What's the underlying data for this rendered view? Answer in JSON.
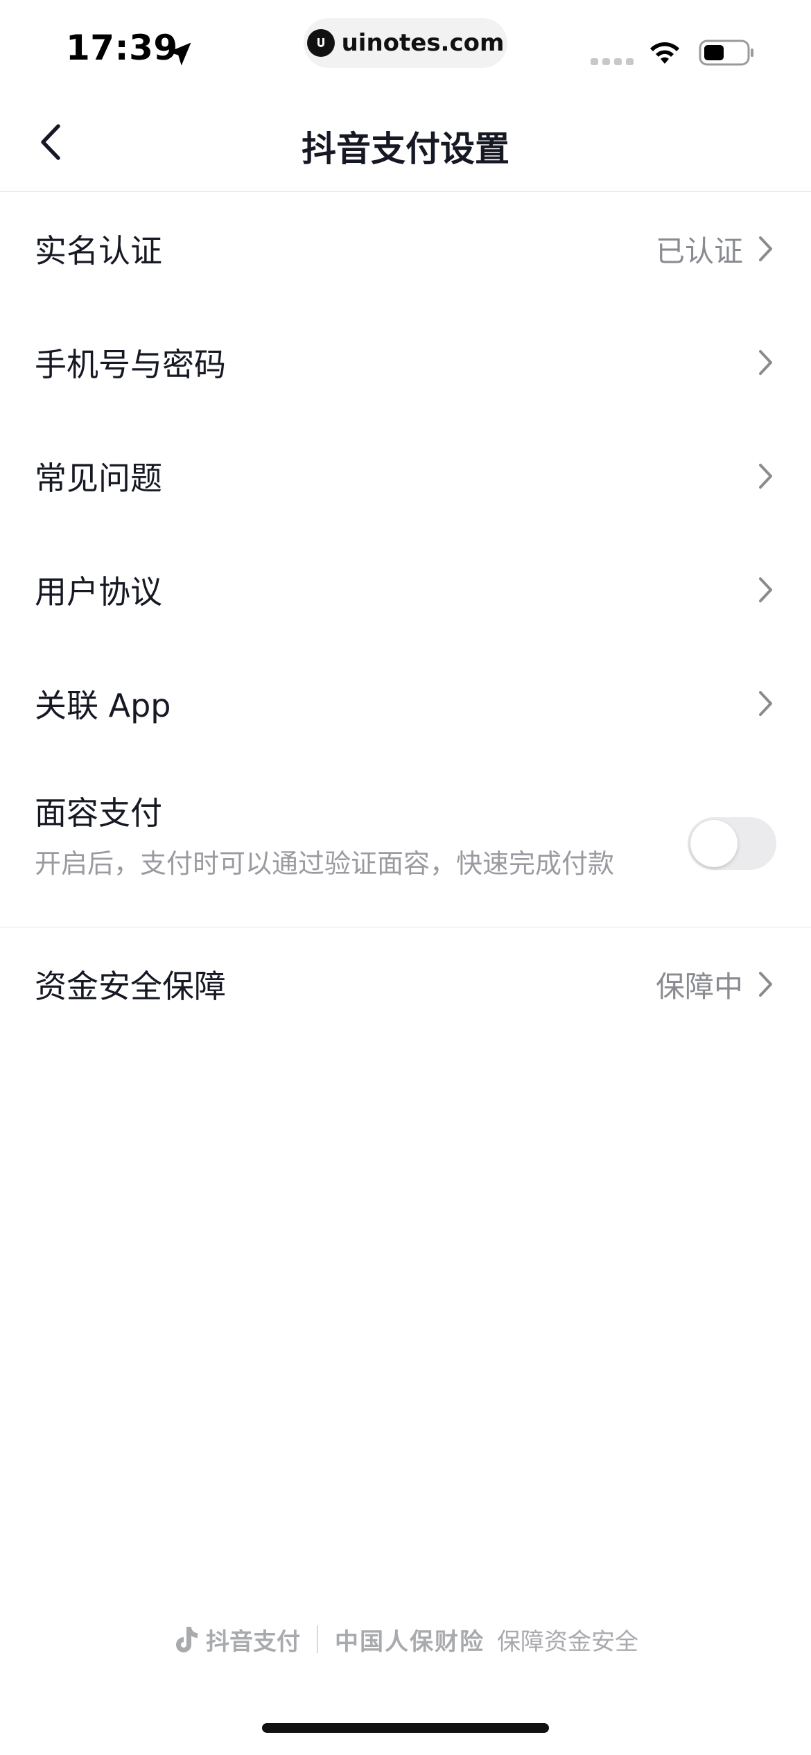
{
  "status_bar": {
    "time": "17:39",
    "url": "uinotes.com",
    "icons": [
      "location-arrow-icon",
      "signal-icon",
      "wifi-icon",
      "battery-icon"
    ]
  },
  "header": {
    "title": "抖音支付设置",
    "back_icon": "chevron-left-icon"
  },
  "settings": {
    "items": [
      {
        "label": "实名认证",
        "value": "已认证"
      },
      {
        "label": "手机号与密码",
        "value": ""
      },
      {
        "label": "常见问题",
        "value": ""
      },
      {
        "label": "用户协议",
        "value": ""
      },
      {
        "label": "关联 App",
        "value": ""
      }
    ],
    "face_pay": {
      "title": "面容支付",
      "description": "开启后，支付时可以通过验证面容，快速完成付款",
      "enabled": false
    },
    "fund_security": {
      "label": "资金安全保障",
      "value": "保障中"
    }
  },
  "footer": {
    "brand": "抖音支付",
    "partner": "中国人保财险",
    "slogan": "保障资金安全"
  },
  "colors": {
    "text_primary": "#161823",
    "text_secondary": "#8a8b91",
    "divider": "#e6e6e8",
    "toggle_off": "#ebebed"
  }
}
